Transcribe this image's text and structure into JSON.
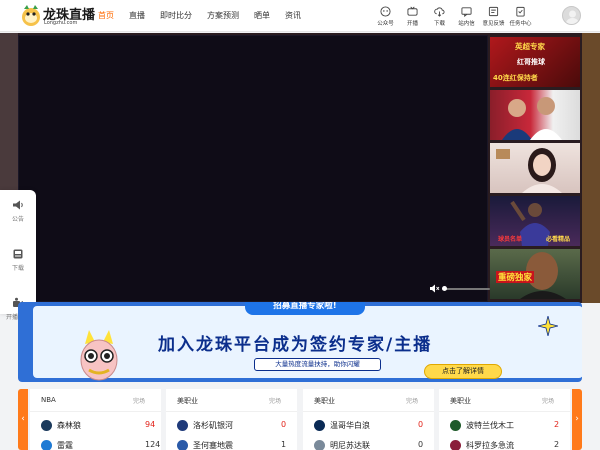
{
  "header": {
    "logo_text": "龙珠直播",
    "logo_domain": "Longzhu.com",
    "nav": [
      {
        "label": "首页",
        "active": true
      },
      {
        "label": "直播",
        "active": false
      },
      {
        "label": "即时比分",
        "active": false
      },
      {
        "label": "方案预测",
        "active": false
      },
      {
        "label": "晒单",
        "active": false
      },
      {
        "label": "资讯",
        "active": false
      }
    ],
    "tools": [
      {
        "label": "公众号",
        "icon": "official-account-icon"
      },
      {
        "label": "开播",
        "icon": "tv-icon"
      },
      {
        "label": "下载",
        "icon": "cloud-download-icon"
      },
      {
        "label": "站内信",
        "icon": "message-icon"
      },
      {
        "label": "意见反馈",
        "icon": "feedback-icon"
      },
      {
        "label": "任务中心",
        "icon": "task-icon"
      }
    ]
  },
  "player": {
    "volume_level": 0.05
  },
  "thumbnails": [
    {
      "lines": [
        "英超专家",
        "红哥推球",
        "40连红保持者"
      ],
      "color": "#7a1010"
    },
    {
      "lines": [],
      "color": "#b81c24"
    },
    {
      "lines": [],
      "color": "#e8d7d2"
    },
    {
      "lines": [
        "球员名单",
        "必看精品"
      ],
      "color": "#2a2350"
    },
    {
      "lines": [
        "重磅独家"
      ],
      "color": "#3a5a2a"
    }
  ],
  "float_bar": [
    {
      "label": "公告",
      "icon": "announcement-icon"
    },
    {
      "label": "下载",
      "icon": "download-icon"
    },
    {
      "label": "开播教程",
      "icon": "tutorial-icon"
    }
  ],
  "banner": {
    "top_tag": "招募直播专家啦!",
    "main_text": "加入龙珠平台成为签约专家/主播",
    "sub_text": "大量热度流量扶持，助你闪耀",
    "button": "点击了解详情"
  },
  "scores": [
    {
      "league": "NBA",
      "status": "完场",
      "teams": [
        {
          "name": "森林狼",
          "score": "94",
          "win": true,
          "color": "#1b3a5c"
        },
        {
          "name": "雷霆",
          "score": "124",
          "win": false,
          "color": "#1e7ad4"
        }
      ]
    },
    {
      "league": "美职业",
      "status": "完场",
      "teams": [
        {
          "name": "洛杉矶银河",
          "score": "0",
          "win": true,
          "color": "#1f3a7a"
        },
        {
          "name": "圣何塞地震",
          "score": "1",
          "win": false,
          "color": "#2a5aa8"
        }
      ]
    },
    {
      "league": "美职业",
      "status": "完场",
      "teams": [
        {
          "name": "温哥华白浪",
          "score": "0",
          "win": true,
          "color": "#0a2a55"
        },
        {
          "name": "明尼苏达联",
          "score": "0",
          "win": false,
          "color": "#7a8a9a"
        }
      ]
    },
    {
      "league": "美职业",
      "status": "完场",
      "teams": [
        {
          "name": "波特兰伐木工",
          "score": "2",
          "win": true,
          "color": "#1e5a2a"
        },
        {
          "name": "科罗拉多急流",
          "score": "2",
          "win": false,
          "color": "#8a1e3a"
        }
      ]
    }
  ],
  "colors": {
    "accent": "#ff6a00",
    "score_win": "#e2231a",
    "banner_blue": "#2f6fd6"
  }
}
